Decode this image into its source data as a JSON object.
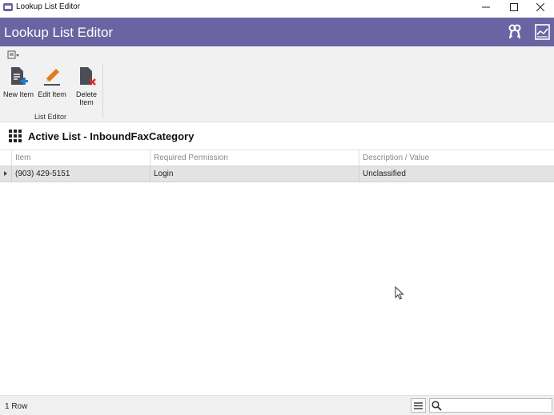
{
  "window": {
    "title": "Lookup List Editor",
    "app_icon": "app-icon",
    "controls": [
      "minimize-icon",
      "maximize-icon",
      "close-icon"
    ]
  },
  "header": {
    "title": "Lookup List Editor",
    "icons": [
      "keys-icon",
      "report-icon"
    ],
    "accent_color": "#6a64a3"
  },
  "ribbon": {
    "quick_access_icon": "quick-access-menu-icon",
    "buttons": [
      {
        "label": "New Item",
        "icon": "new-item-icon"
      },
      {
        "label": "Edit Item",
        "icon": "edit-item-icon"
      },
      {
        "label_line1": "Delete",
        "label_line2": "Item",
        "icon": "delete-item-icon"
      }
    ],
    "group_label": "List Editor"
  },
  "list": {
    "title": "Active List - InboundFaxCategory",
    "columns": [
      "Item",
      "Required Permission",
      "Description / Value"
    ],
    "rows": [
      {
        "item": "(903) 429-5151",
        "permission": "Login",
        "description": "Unclassified"
      }
    ]
  },
  "status": {
    "row_count": "1 Row",
    "search_placeholder": "",
    "search_value": ""
  }
}
